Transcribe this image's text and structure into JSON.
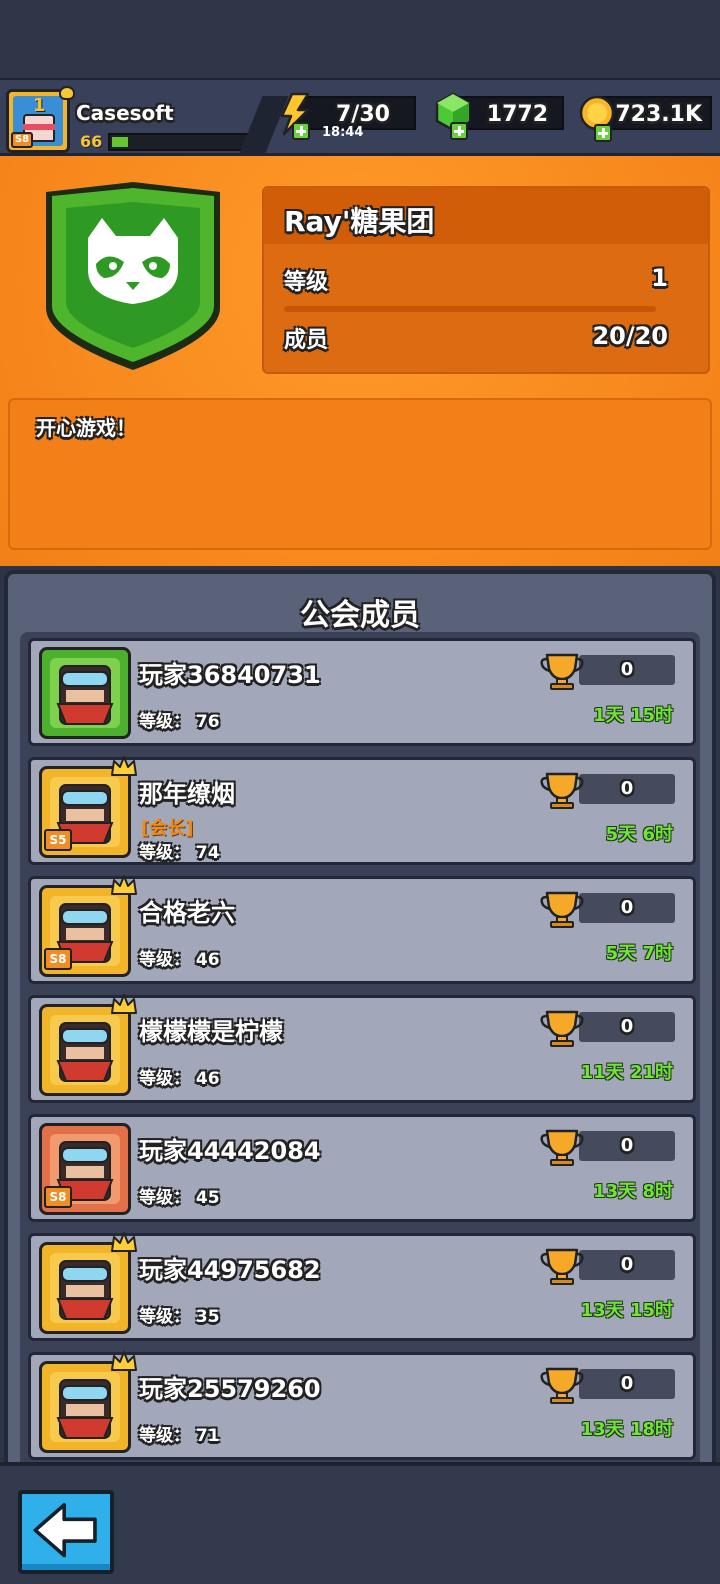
{
  "player": {
    "name": "Casesoft",
    "level": "66",
    "season": "S8",
    "xp_progress": 0.12
  },
  "resources": {
    "energy": "7/30",
    "energy_timer": "18:44",
    "gems": "1772",
    "coins": "723.1K"
  },
  "guild": {
    "name": "Ray'糖果团",
    "level_label": "等级",
    "level_value": "1",
    "members_label": "成员",
    "members_value": "20/20",
    "motto": "开心游戏！",
    "emblem_icon": "raccoon-shield-icon"
  },
  "members_section": {
    "title": "公会成员",
    "level_prefix": "等级：",
    "members": [
      {
        "name": "玩家36840731",
        "level": "76",
        "role": "",
        "trophies": "0",
        "last_online": "1天 15时",
        "frame": "green",
        "season": ""
      },
      {
        "name": "那年缭烟",
        "level": "74",
        "role": "[会长]",
        "trophies": "0",
        "last_online": "5天 6时",
        "frame": "gold",
        "season": "S5"
      },
      {
        "name": "合格老六",
        "level": "46",
        "role": "",
        "trophies": "0",
        "last_online": "5天 7时",
        "frame": "gold",
        "season": "S8"
      },
      {
        "name": "檬檬檬是柠檬",
        "level": "46",
        "role": "",
        "trophies": "0",
        "last_online": "11天 21时",
        "frame": "gold",
        "season": ""
      },
      {
        "name": "玩家44442084",
        "level": "45",
        "role": "",
        "trophies": "0",
        "last_online": "13天 8时",
        "frame": "red",
        "season": "S8"
      },
      {
        "name": "玩家44975682",
        "level": "35",
        "role": "",
        "trophies": "0",
        "last_online": "13天 15时",
        "frame": "gold",
        "season": ""
      },
      {
        "name": "玩家25579260",
        "level": "71",
        "role": "",
        "trophies": "0",
        "last_online": "13天 18时",
        "frame": "gold",
        "season": ""
      }
    ]
  },
  "colors": {
    "orange_bg": "#f88a1e",
    "panel_gray": "#a2a8b9",
    "online_green": "#72e23c",
    "leader_orange": "#f18a18"
  }
}
